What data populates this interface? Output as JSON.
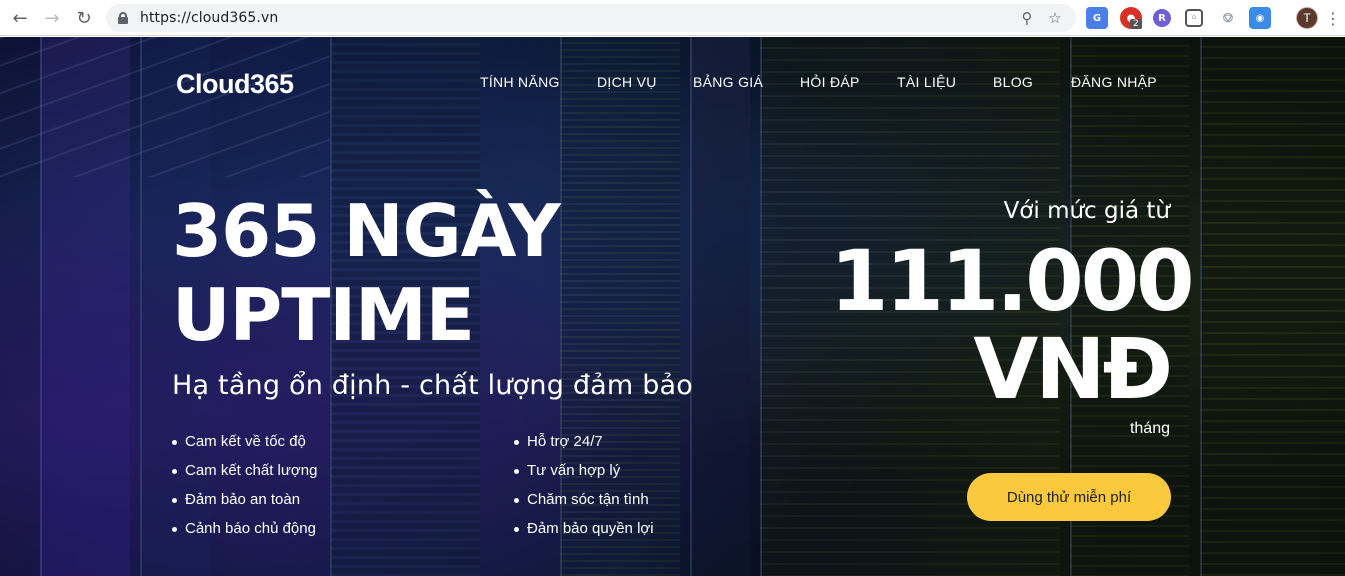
{
  "browser": {
    "url": "https://cloud365.vn",
    "icons": {
      "back": "back-arrow-icon",
      "forward": "forward-arrow-icon",
      "reload": "reload-icon",
      "lock": "lock-icon",
      "zoom": "zoom-icon",
      "bookmark": "star-icon",
      "menu": "more-vert-icon"
    },
    "extensions": {
      "red_badge_count": "2",
      "r_label": "R"
    },
    "profile_initial": "T"
  },
  "site": {
    "logo": "Cloud365",
    "nav": [
      "TÍNH NĂNG",
      "DỊCH VỤ",
      "BẢNG GIÁ",
      "HỎI ĐÁP",
      "TÀI LIỆU",
      "BLOG",
      "ĐĂNG NHẬP"
    ],
    "hero": {
      "headline_line1": "365 NGÀY",
      "headline_line2": "UPTIME",
      "subheadline": "Hạ tầng ổn định - chất lượng đảm bảo",
      "features_left": [
        "Cam kết về tốc độ",
        "Cam kết chất lượng",
        "Đảm bảo an toàn",
        "Cảnh báo chủ động"
      ],
      "features_right": [
        "Hỗ trợ 24/7",
        "Tư vấn hợp lý",
        "Chăm sóc tận tình",
        "Đảm bảo quyền lợi"
      ],
      "price_intro": "Với mức giá từ",
      "price_amount": "111.000",
      "price_currency": "VNĐ",
      "price_period": "tháng",
      "cta_label": "Dùng thử miễn phí"
    },
    "colors": {
      "cta_background": "#fbc93d",
      "text": "#ffffff"
    }
  }
}
